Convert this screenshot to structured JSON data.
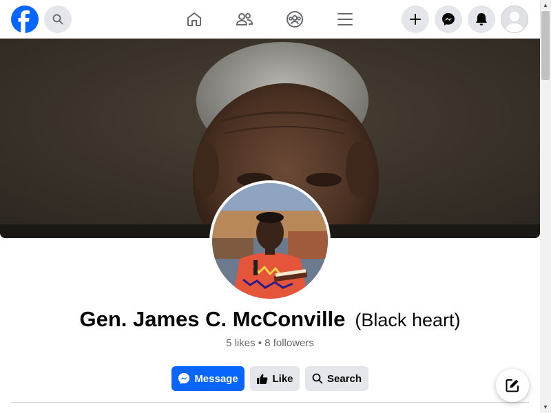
{
  "page": {
    "name": "Gen. James C. McConville",
    "name_suffix": "(Black heart)",
    "stats": "5 likes • 8 followers"
  },
  "actions": {
    "message_label": "Message",
    "like_label": "Like",
    "search_label": "Search"
  },
  "topbar": {
    "logo_icon": "facebook-logo-icon",
    "nav_icons": [
      "home-icon",
      "friends-icon",
      "groups-icon",
      "menu-icon"
    ],
    "right_icons": [
      "plus-icon",
      "messenger-icon",
      "bell-icon",
      "account-avatar-icon"
    ]
  },
  "colors": {
    "brand": "#0866ff",
    "secondary_button": "#e4e6eb",
    "text_primary": "#050505",
    "text_secondary": "#65676b"
  },
  "icons": {
    "fab": "compose-icon"
  }
}
